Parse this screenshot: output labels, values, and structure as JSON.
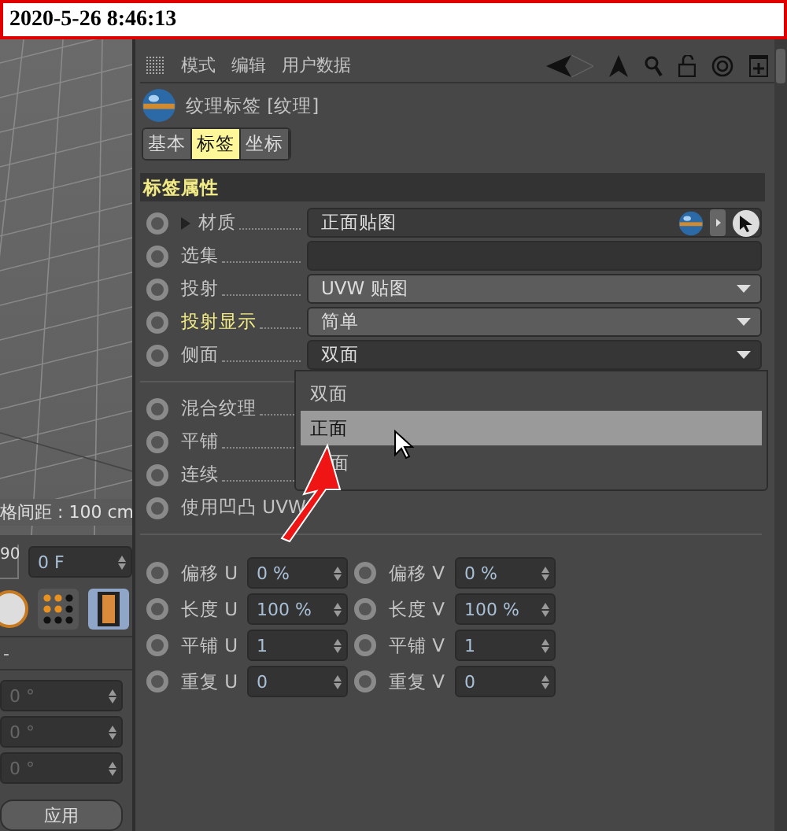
{
  "timestamp": "2020-5-26 8:46:13",
  "viewport": {
    "grid_spacing": "格间距 : 100 cm"
  },
  "timeline": {
    "ruler": "90",
    "frame": "0 F"
  },
  "coords": {
    "header": "-",
    "fields": [
      "0 °",
      "0 °",
      "0 °"
    ],
    "apply": "应用"
  },
  "menu": [
    "模式",
    "编辑",
    "用户数据"
  ],
  "object": {
    "title": "纹理标签 [纹理]"
  },
  "tabs": [
    {
      "label": "基本",
      "selected": false
    },
    {
      "label": "标签",
      "selected": true
    },
    {
      "label": "坐标",
      "selected": false
    }
  ],
  "section": "标签属性",
  "properties": [
    {
      "kind": "link",
      "label": "材质",
      "value": "正面贴图",
      "highlighted": false,
      "keyframe": false
    },
    {
      "kind": "field",
      "label": "选集",
      "highlighted": false,
      "keyframe": false
    },
    {
      "kind": "dropdown",
      "label": "投射",
      "value": "UVW 贴图",
      "highlighted": false,
      "keyframe": false,
      "open": false
    },
    {
      "kind": "dropdown",
      "label": "投射显示",
      "value": "简单",
      "highlighted": true,
      "keyframe": false,
      "open": false
    },
    {
      "kind": "dropdown",
      "label": "侧面",
      "value": "双面",
      "highlighted": false,
      "keyframe": false,
      "open": true
    },
    {
      "kind": "divider"
    },
    {
      "kind": "checkbox",
      "label": "混合纹理",
      "highlighted": false,
      "keyframe": false
    },
    {
      "kind": "checkbox",
      "label": "平铺",
      "highlighted": false,
      "keyframe": false
    },
    {
      "kind": "checkbox",
      "label": "连续",
      "highlighted": false,
      "keyframe": false
    },
    {
      "kind": "checkbox",
      "label": "使用凹凸 UVW",
      "highlighted": false,
      "keyframe": false
    }
  ],
  "dropdown_list": [
    {
      "label": "双面",
      "selected": false,
      "covered": false
    },
    {
      "label": "正面",
      "selected": true,
      "covered": false
    },
    {
      "label": "面",
      "selected": false,
      "covered": true
    }
  ],
  "params": [
    {
      "label": "偏移 U",
      "value": "0 %",
      "keyframe": false
    },
    {
      "label": "偏移 V",
      "value": "0 %",
      "keyframe": false
    },
    {
      "label": "长度 U",
      "value": "100 %",
      "keyframe": false
    },
    {
      "label": "长度 V",
      "value": "100 %",
      "keyframe": false
    },
    {
      "label": "平铺 U",
      "value": "1",
      "keyframe": false
    },
    {
      "label": "平铺 V",
      "value": "1",
      "keyframe": false
    },
    {
      "label": "重复 U",
      "value": "0",
      "keyframe": false
    },
    {
      "label": "重复 V",
      "value": "0",
      "keyframe": false
    }
  ]
}
